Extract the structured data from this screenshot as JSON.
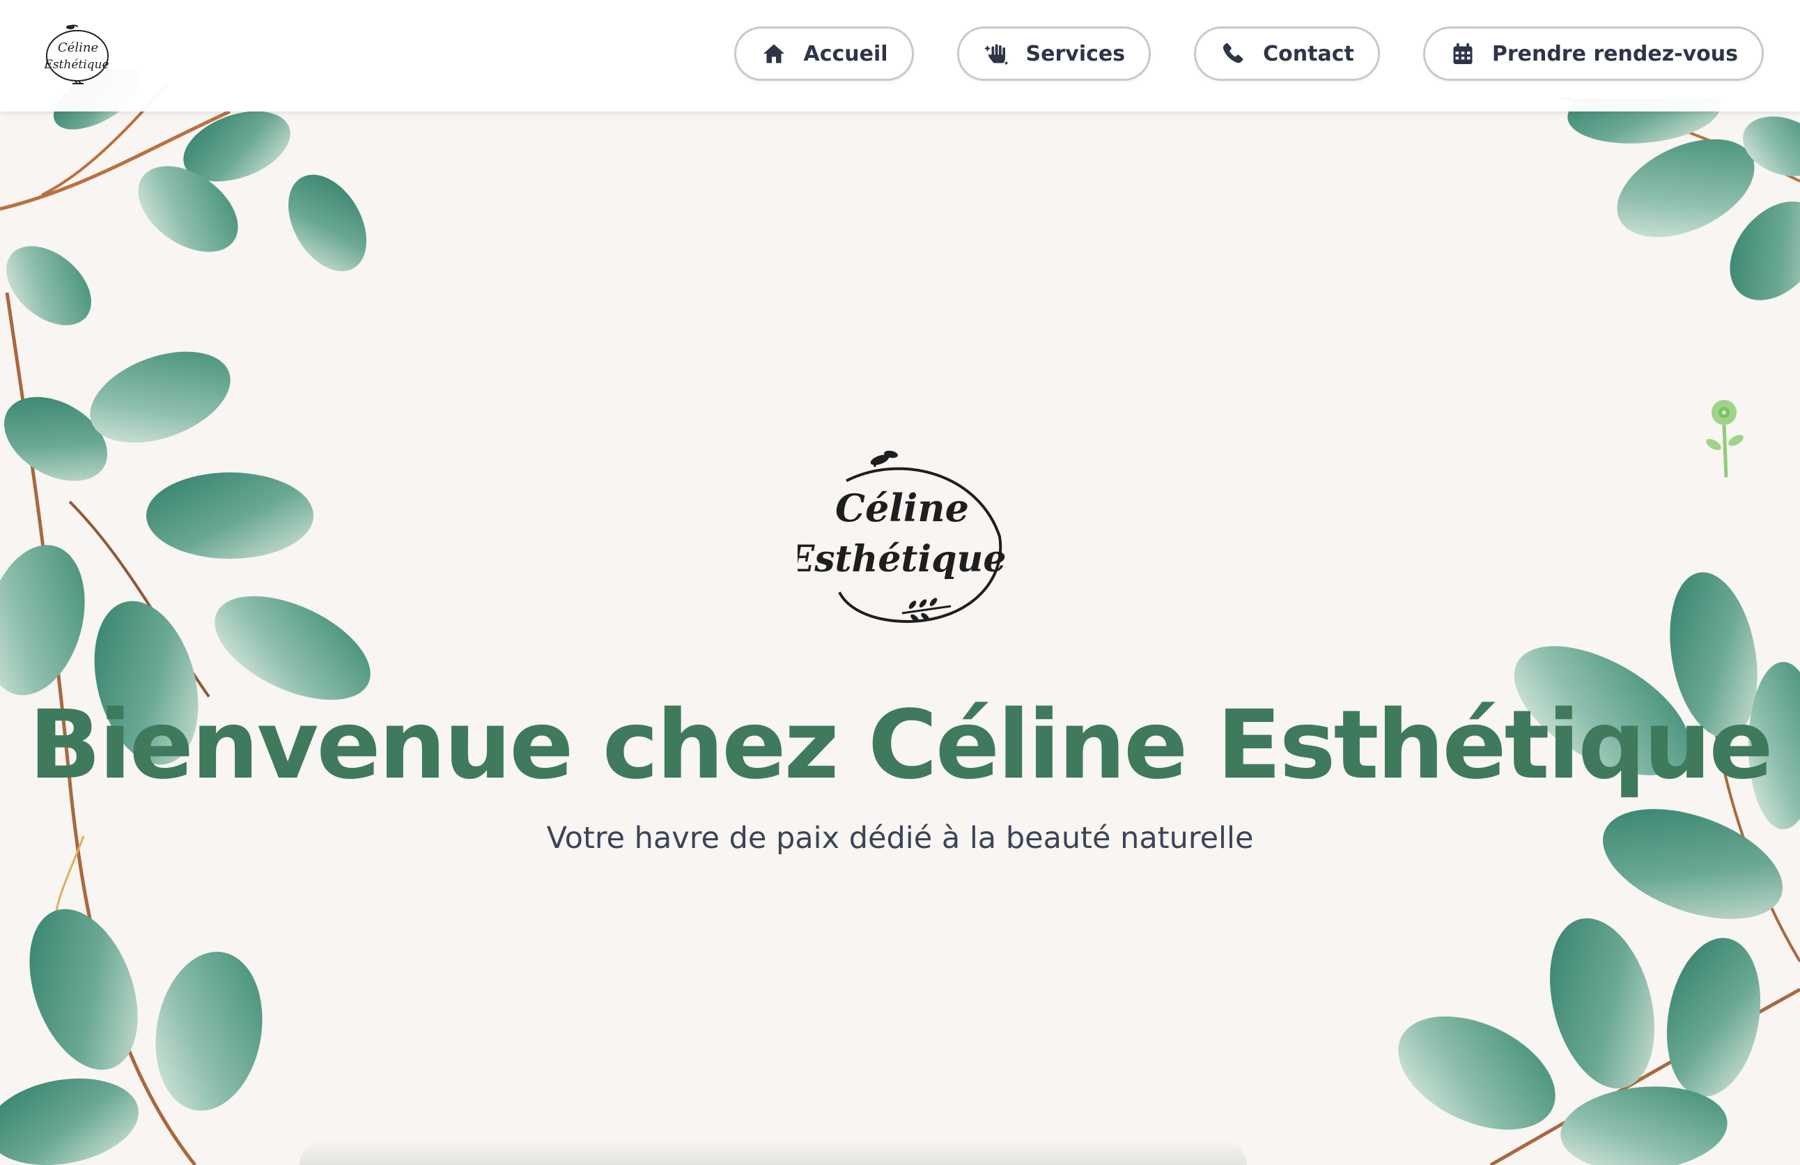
{
  "brand": {
    "logo_line1": "Céline",
    "logo_line2": "Esthétique"
  },
  "nav": {
    "items": [
      {
        "label": "Accueil",
        "icon": "home-icon"
      },
      {
        "label": "Services",
        "icon": "hands-sparkles-icon"
      },
      {
        "label": "Contact",
        "icon": "phone-icon"
      },
      {
        "label": "Prendre rendez-vous",
        "icon": "calendar-icon"
      }
    ]
  },
  "hero": {
    "title": "Bienvenue chez Céline Esthétique",
    "subtitle": "Votre havre de paix dédié à la beauté naturelle"
  },
  "colors": {
    "accent_green": "#3e7a5b",
    "text_dark": "#2d3648",
    "background": "#f8f5f2",
    "leaf_green": "#4f9a80"
  }
}
